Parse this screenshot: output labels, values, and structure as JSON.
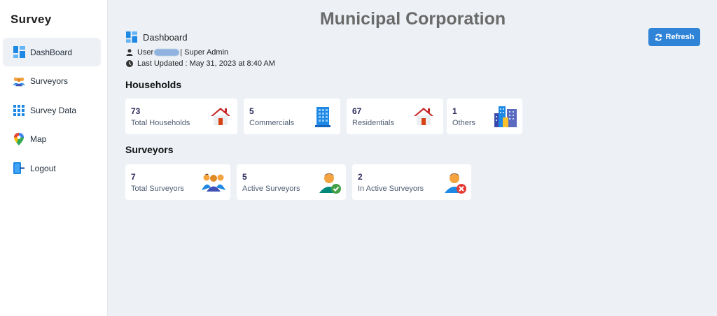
{
  "app": {
    "brand": "Survey",
    "title": "Municipal Corporation"
  },
  "sidebar": {
    "items": [
      {
        "label": "DashBoard",
        "icon": "dashboard-icon",
        "active": true
      },
      {
        "label": "Surveyors",
        "icon": "people-icon",
        "active": false
      },
      {
        "label": "Survey Data",
        "icon": "grid-icon",
        "active": false
      },
      {
        "label": "Map",
        "icon": "map-pin-icon",
        "active": false
      },
      {
        "label": "Logout",
        "icon": "logout-icon",
        "active": false
      }
    ]
  },
  "header": {
    "dashboard_label": "Dashboard",
    "user_prefix": "User",
    "user_role": "| Super Admin",
    "last_updated": "Last Updated : May 31, 2023 at 8:40 AM",
    "refresh_label": "Refresh"
  },
  "households": {
    "title": "Households",
    "cards": [
      {
        "value": "73",
        "label": "Total Households",
        "icon": "house-icon"
      },
      {
        "value": "5",
        "label": "Commercials",
        "icon": "office-building-icon"
      },
      {
        "value": "67",
        "label": "Residentials",
        "icon": "house-icon"
      },
      {
        "value": "1",
        "label": "Others",
        "icon": "city-buildings-icon"
      }
    ]
  },
  "surveyors": {
    "title": "Surveyors",
    "cards": [
      {
        "value": "7",
        "label": "Total Surveyors",
        "icon": "group-icon"
      },
      {
        "value": "5",
        "label": "Active Surveyors",
        "icon": "user-check-icon"
      },
      {
        "value": "2",
        "label": "In Active Surveyors",
        "icon": "user-remove-icon"
      }
    ]
  },
  "colors": {
    "accent": "#2f84d8",
    "background": "#edf1f6",
    "title_gray": "#6a6a6a",
    "card_value": "#2e2e5e"
  }
}
